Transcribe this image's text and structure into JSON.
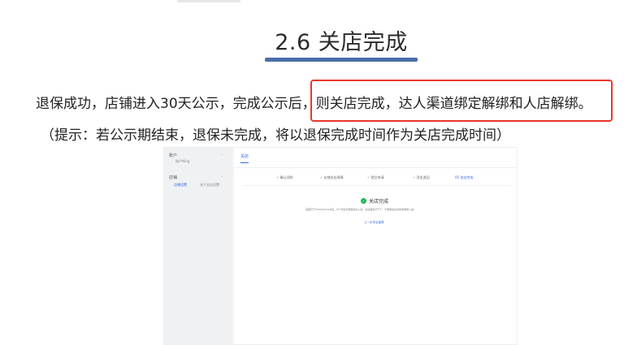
{
  "title": "2.6 关店完成",
  "body": {
    "line1": "退保成功，店铺进入30天公示，完成公示后，则关店完成，达人渠道绑定解绑和人店解绑。",
    "line2": "（提示：若公示期结束，退保未完成，将以退保完成时间作为关店完成时间）"
  },
  "shot": {
    "sidebar": {
      "account": "账户",
      "account_sub": "账户Ning",
      "section": "店铺",
      "item_active": "店铺设置",
      "item_other": "关于关店设置",
      "arrow": "›"
    },
    "tab": "关店",
    "steps": [
      "确认须知",
      "店铺关店保障",
      "提交申请",
      "资金退回",
      "05 关店完成"
    ],
    "step_check": "✓",
    "result_title": "关店完成",
    "result_desc": "店铺已于2023/03/14关店，8个月后可重新提交入驻，您店铺也已于下，可重新提交资料的重新入驻",
    "result_link": "上一步关店保障"
  }
}
